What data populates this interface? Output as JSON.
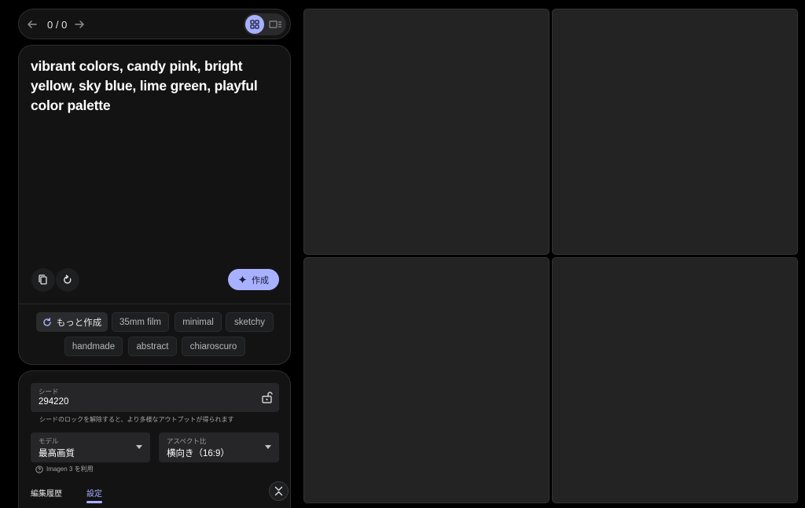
{
  "nav": {
    "counter": "0 / 0",
    "prev_icon": "arrow-left-icon",
    "next_icon": "arrow-right-icon",
    "view_grid_icon": "grid-icon",
    "view_single_icon": "single-view-icon"
  },
  "prompt": {
    "text": "vibrant colors, candy pink, bright yellow, sky blue, lime green, playful color palette",
    "copy_icon": "copy-icon",
    "reset_icon": "reset-icon",
    "create_label": "作成",
    "create_icon": "sparkle-icon"
  },
  "chips": {
    "more_label": "もっと作成",
    "items": [
      "35mm film",
      "minimal",
      "sketchy",
      "handmade",
      "abstract",
      "chiaroscuro"
    ]
  },
  "settings": {
    "seed": {
      "label": "シード",
      "value": "294220",
      "helper": "シードのロックを解除すると、より多様なアウトプットが得られます"
    },
    "model": {
      "label": "モデル",
      "value": "最高画質"
    },
    "aspect": {
      "label": "アスペクト比",
      "value": "横向き（16:9）"
    },
    "model_note": "Imagen 3 を利用",
    "tabs": [
      "編集履歴",
      "設定"
    ],
    "active_tab": "設定"
  },
  "colors": {
    "accent": "#a8b1ff",
    "panel": "#131314",
    "tile": "#232323"
  }
}
